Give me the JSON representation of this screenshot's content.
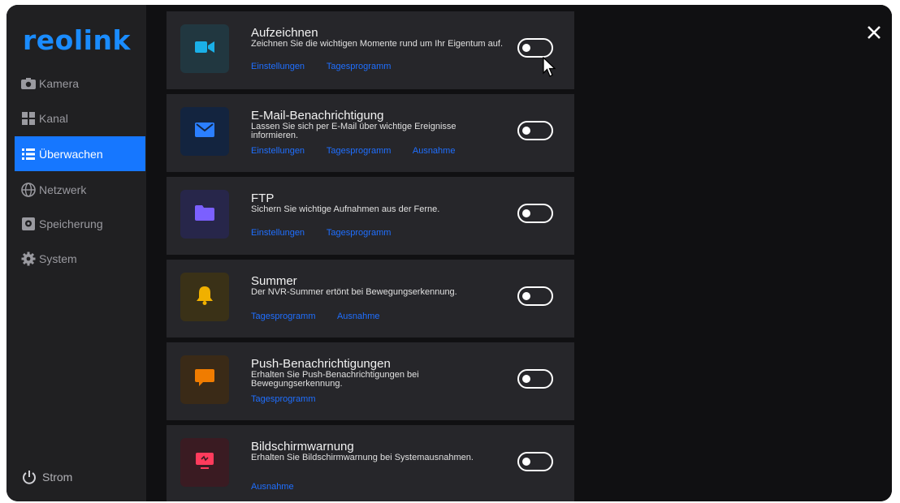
{
  "sidebar": {
    "logo": "reolink",
    "items": [
      {
        "label": "Kamera",
        "icon": "camera-icon",
        "active": false
      },
      {
        "label": "Kanal",
        "icon": "grid-icon",
        "active": false
      },
      {
        "label": "Überwachen",
        "icon": "list-icon",
        "active": true
      },
      {
        "label": "Netzwerk",
        "icon": "globe-icon",
        "active": false
      },
      {
        "label": "Speicherung",
        "icon": "storage-icon",
        "active": false
      },
      {
        "label": "System",
        "icon": "gear-icon",
        "active": false
      }
    ],
    "power_label": "Strom"
  },
  "cards": [
    {
      "title": "Aufzeichnen",
      "description": "Zeichnen Sie die wichtigen Momente rund um Ihr Eigentum auf.",
      "links": [
        "Einstellungen",
        "Tagesprogramm"
      ],
      "icon": "video-camera-icon",
      "icon_color": "#1ab0e8",
      "tile_color": "#213740",
      "enabled": false
    },
    {
      "title": "E-Mail-Benachrichtigung",
      "description": "Lassen Sie sich per E-Mail über wichtige Ereignisse informieren.",
      "links": [
        "Einstellungen",
        "Tagesprogramm",
        "Ausnahme"
      ],
      "icon": "mail-icon",
      "icon_color": "#2b7fff",
      "tile_color": "#13243f",
      "enabled": false
    },
    {
      "title": "FTP",
      "description": "Sichern Sie wichtige Aufnahmen aus der Ferne.",
      "links": [
        "Einstellungen",
        "Tagesprogramm"
      ],
      "icon": "folder-icon",
      "icon_color": "#7b60ff",
      "tile_color": "#27264a",
      "enabled": false
    },
    {
      "title": "Summer",
      "description": "Der NVR-Summer ertönt bei Bewegungserkennung.",
      "links": [
        "Tagesprogramm",
        "Ausnahme"
      ],
      "icon": "bell-icon",
      "icon_color": "#f0b000",
      "tile_color": "#3a3117",
      "enabled": false
    },
    {
      "title": "Push-Benachrichtigungen",
      "description": "Erhalten Sie Push-Benachrichtigungen bei Bewegungserkennung.",
      "links": [
        "Tagesprogramm"
      ],
      "icon": "message-icon",
      "icon_color": "#f07c00",
      "tile_color": "#3a2a17",
      "enabled": false
    },
    {
      "title": "Bildschirmwarnung",
      "description": "Erhalten Sie Bildschirmwarnung bei Systemausnahmen.",
      "links": [
        "Ausnahme"
      ],
      "icon": "monitor-alert-icon",
      "icon_color": "#ff3b5c",
      "tile_color": "#3a1b22",
      "enabled": false
    }
  ],
  "colors": {
    "accent": "#1677ff",
    "link": "#1f6fff"
  }
}
